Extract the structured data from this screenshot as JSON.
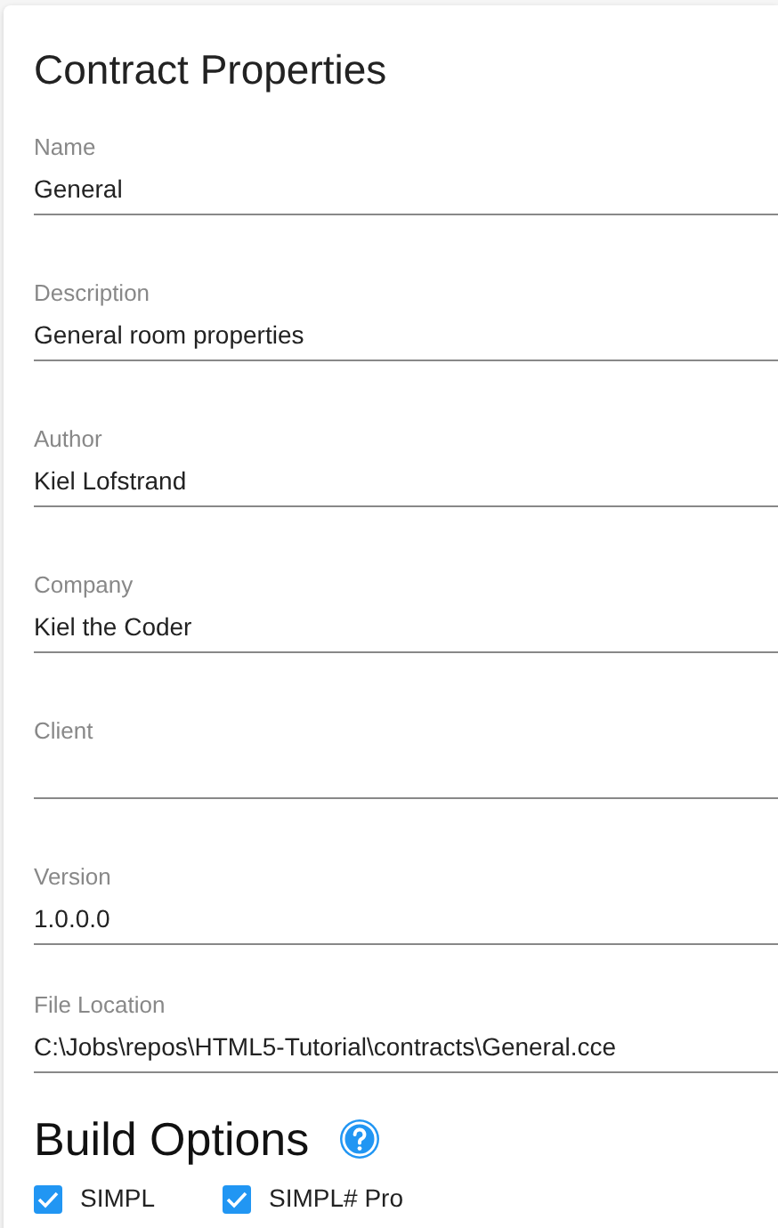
{
  "title": "Contract Properties",
  "fields": [
    {
      "label": "Name",
      "value": "General"
    },
    {
      "label": "Description",
      "value": "General room properties"
    },
    {
      "label": "Author",
      "value": "Kiel Lofstrand"
    },
    {
      "label": "Company",
      "value": "Kiel the Coder"
    },
    {
      "label": "Client"
    },
    {
      "label": "Version",
      "value": "1.0.0.0"
    },
    {
      "label": "File Location",
      "value": "C:\\Jobs\\repos\\HTML5-Tutorial\\contracts\\General.cce"
    }
  ],
  "build_options": {
    "title": "Build Options",
    "options": [
      {
        "label": "SIMPL",
        "checked": true
      },
      {
        "label": "SIMPL# Pro",
        "checked": true
      }
    ]
  }
}
